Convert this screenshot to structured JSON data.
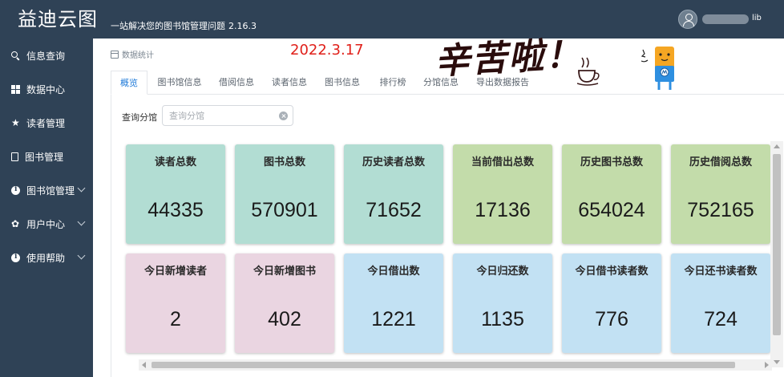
{
  "header": {
    "logo": "益迪云图",
    "subtitle": "一站解决您的图书馆管理问题",
    "version": "2.16.3",
    "user_suffix": "lib"
  },
  "sidebar": {
    "items": [
      {
        "label": "信息查询",
        "icon": "search-icon",
        "expandable": false
      },
      {
        "label": "数据中心",
        "icon": "grid-icon",
        "expandable": false
      },
      {
        "label": "读者管理",
        "icon": "star-icon",
        "expandable": false
      },
      {
        "label": "图书管理",
        "icon": "book-icon",
        "expandable": false
      },
      {
        "label": "图书馆管理",
        "icon": "info-icon",
        "expandable": true
      },
      {
        "label": "用户中心",
        "icon": "gear-icon",
        "expandable": true
      },
      {
        "label": "使用帮助",
        "icon": "info-icon",
        "expandable": true
      }
    ]
  },
  "page": {
    "breadcrumb": "数据统计",
    "date_annotation": "2022.3.17",
    "kudos": "辛苦啦！",
    "decoration_icons": [
      "coffee-cup-icon",
      "mascot-icon"
    ]
  },
  "tabs": [
    {
      "label": "概览",
      "active": true
    },
    {
      "label": "图书馆信息",
      "active": false
    },
    {
      "label": "借阅信息",
      "active": false
    },
    {
      "label": "读者信息",
      "active": false
    },
    {
      "label": "图书信息",
      "active": false
    },
    {
      "label": "排行榜",
      "active": false
    },
    {
      "label": "分馆信息",
      "active": false
    },
    {
      "label": "导出数据报告",
      "active": false
    }
  ],
  "filter": {
    "label": "查询分馆",
    "placeholder": "查询分馆",
    "value": ""
  },
  "cards": [
    {
      "title": "读者总数",
      "value": "44335",
      "color": "#b2ddd3"
    },
    {
      "title": "图书总数",
      "value": "570901",
      "color": "#b2ddd3"
    },
    {
      "title": "历史读者总数",
      "value": "71652",
      "color": "#b2ddd3"
    },
    {
      "title": "当前借出总数",
      "value": "17136",
      "color": "#c3dcaa"
    },
    {
      "title": "历史图书总数",
      "value": "654024",
      "color": "#c3dcaa"
    },
    {
      "title": "历史借阅总数",
      "value": "752165",
      "color": "#c3dcaa"
    },
    {
      "title": "今日新增读者",
      "value": "2",
      "color": "#ead5e1"
    },
    {
      "title": "今日新增图书",
      "value": "402",
      "color": "#ead5e1"
    },
    {
      "title": "今日借出数",
      "value": "1221",
      "color": "#c2e1f3"
    },
    {
      "title": "今日归还数",
      "value": "1135",
      "color": "#c2e1f3"
    },
    {
      "title": "今日借书读者数",
      "value": "776",
      "color": "#c2e1f3"
    },
    {
      "title": "今日还书读者数",
      "value": "724",
      "color": "#c2e1f3"
    }
  ]
}
